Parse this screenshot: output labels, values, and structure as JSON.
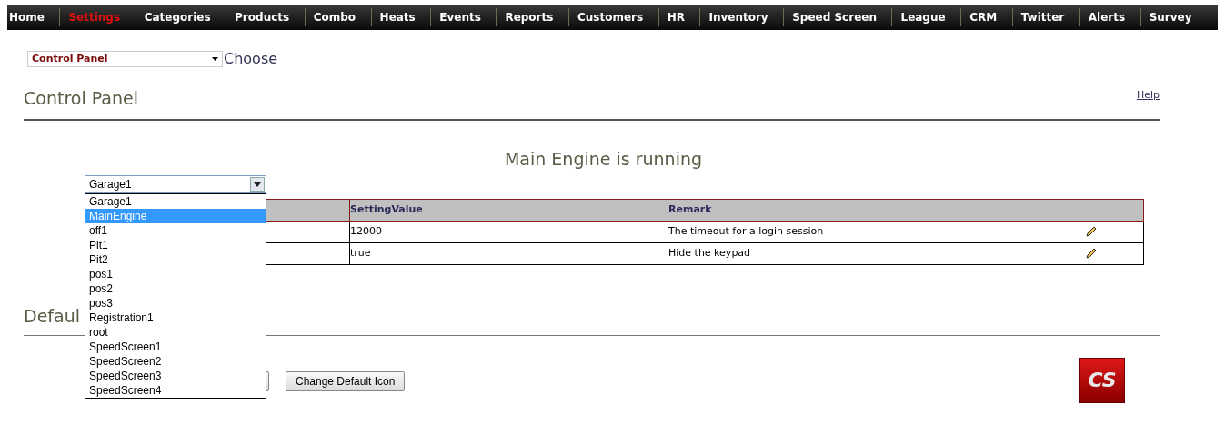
{
  "nav": [
    {
      "label": "Home",
      "selected": false
    },
    {
      "label": "Settings",
      "selected": true
    },
    {
      "label": "Categories",
      "selected": false
    },
    {
      "label": "Products",
      "selected": false
    },
    {
      "label": "Combo",
      "selected": false
    },
    {
      "label": "Heats",
      "selected": false
    },
    {
      "label": "Events",
      "selected": false
    },
    {
      "label": "Reports",
      "selected": false
    },
    {
      "label": "Customers",
      "selected": false
    },
    {
      "label": "HR",
      "selected": false
    },
    {
      "label": "Inventory",
      "selected": false
    },
    {
      "label": "Speed Screen",
      "selected": false
    },
    {
      "label": "League",
      "selected": false
    },
    {
      "label": "CRM",
      "selected": false
    },
    {
      "label": "Twitter",
      "selected": false
    },
    {
      "label": "Alerts",
      "selected": false
    },
    {
      "label": "Survey",
      "selected": false
    }
  ],
  "page_select": {
    "value": "Control Panel",
    "button": "Choose"
  },
  "heading": "Control Panel",
  "help_link": "Help",
  "status": "Main Engine is running",
  "group_select": {
    "value": "Garage1",
    "expanded": true,
    "options": [
      {
        "label": "Garage1",
        "highlighted": false
      },
      {
        "label": "MainEngine",
        "highlighted": true
      },
      {
        "label": "off1",
        "highlighted": false
      },
      {
        "label": "Pit1",
        "highlighted": false
      },
      {
        "label": "Pit2",
        "highlighted": false
      },
      {
        "label": "pos1",
        "highlighted": false
      },
      {
        "label": "pos2",
        "highlighted": false
      },
      {
        "label": "pos3",
        "highlighted": false
      },
      {
        "label": "Registration1",
        "highlighted": false
      },
      {
        "label": "root",
        "highlighted": false
      },
      {
        "label": "SpeedScreen1",
        "highlighted": false
      },
      {
        "label": "SpeedScreen2",
        "highlighted": false
      },
      {
        "label": "SpeedScreen3",
        "highlighted": false
      },
      {
        "label": "SpeedScreen4",
        "highlighted": false
      }
    ]
  },
  "table": {
    "columns": [
      "SettingValue",
      "Remark"
    ],
    "rows": [
      {
        "setting_value": "12000",
        "remark": "The timeout for a login session"
      },
      {
        "setting_value": "true",
        "remark": "Hide the keypad"
      }
    ]
  },
  "section_heading": "Defaul",
  "change_icon_button": "Change Default Icon",
  "logo": "CS"
}
